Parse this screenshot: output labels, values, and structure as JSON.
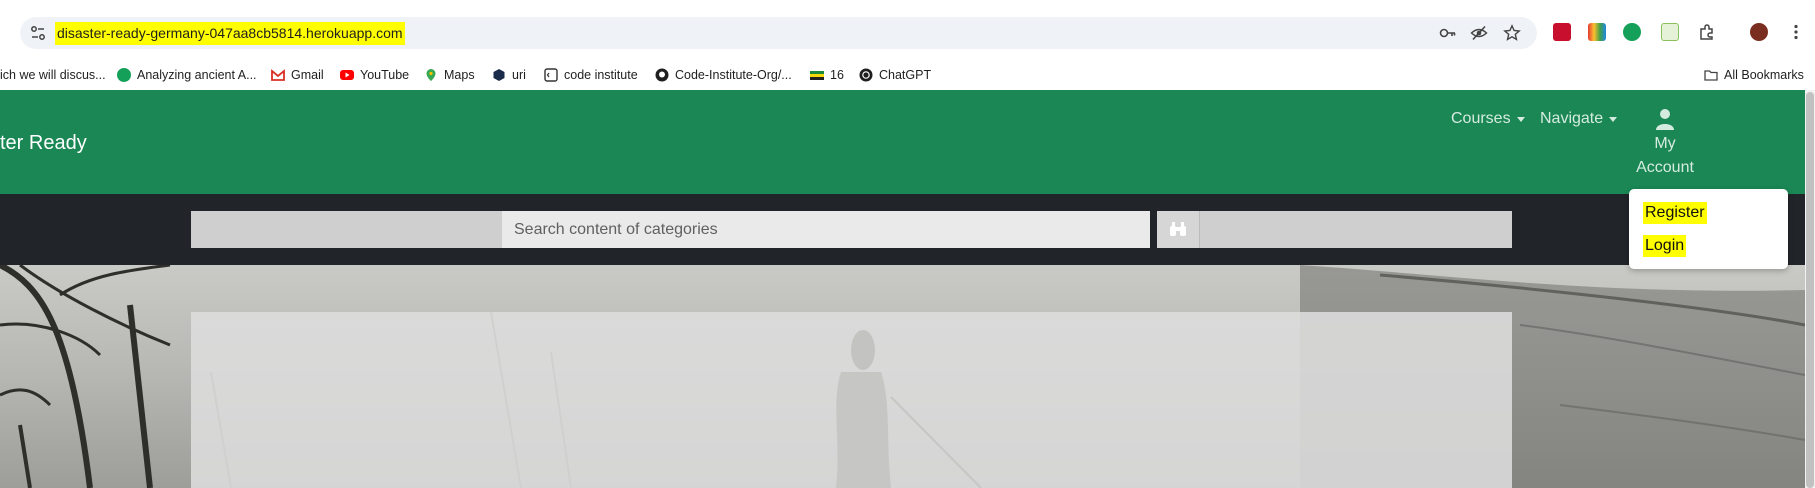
{
  "browser": {
    "url": "disaster-ready-germany-047aa8cb5814.herokuapp.com",
    "bookmarks": [
      {
        "label": "ich we will discus...",
        "icon": "none"
      },
      {
        "label": "Analyzing ancient A...",
        "icon": "grammarly-icon"
      },
      {
        "label": "Gmail",
        "icon": "gmail-icon"
      },
      {
        "label": "YouTube",
        "icon": "youtube-icon"
      },
      {
        "label": "Maps",
        "icon": "maps-icon"
      },
      {
        "label": "uri",
        "icon": "uri-icon"
      },
      {
        "label": "code institute",
        "icon": "code-institute-icon"
      },
      {
        "label": "Code-Institute-Org/...",
        "icon": "github-icon"
      },
      {
        "label": "16",
        "icon": "flag-icon"
      },
      {
        "label": "ChatGPT",
        "icon": "chatgpt-icon"
      }
    ],
    "all_bookmarks": "All Bookmarks"
  },
  "site": {
    "brand": "ter Ready",
    "nav": {
      "courses": "Courses",
      "navigate": "Navigate"
    },
    "account": {
      "line1": "My",
      "line2": "Account"
    },
    "dropdown": {
      "register": "Register",
      "login": "Login"
    },
    "search": {
      "placeholder": "Search content of categories"
    }
  },
  "colors": {
    "navbar": "#1a8754",
    "searchbar": "#212529",
    "highlight": "#ffff00"
  }
}
